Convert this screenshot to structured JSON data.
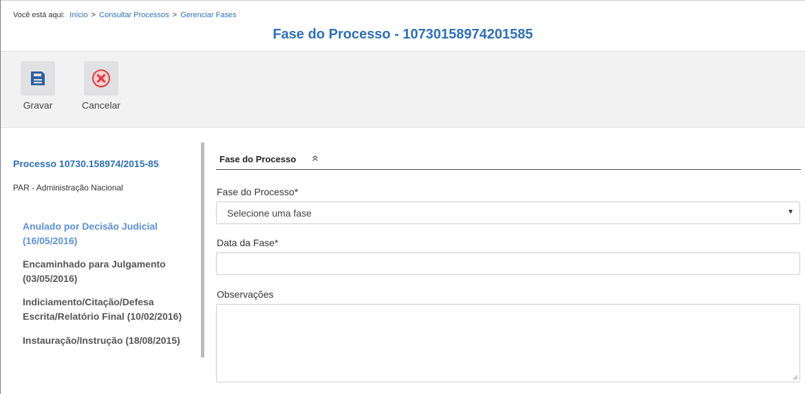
{
  "breadcrumb": {
    "prefix": "Você está aqui:",
    "items": [
      "Início",
      "Consultar Processos",
      "Gerenciar Fases"
    ],
    "separator": ">"
  },
  "page": {
    "title": "Fase do Processo - 10730158974201585"
  },
  "toolbar": {
    "save_label": "Gravar",
    "cancel_label": "Cancelar",
    "save_icon": "save-disk-icon",
    "cancel_icon": "cancel-x-circle-icon"
  },
  "sidebar": {
    "process_title": "Processo 10730.158974/2015-85",
    "process_subtitle": "PAR - Administração Nacional",
    "phases": [
      {
        "label": "Anulado por Decisão Judicial (16/05/2016)",
        "active": true
      },
      {
        "label": "Encaminhado para Julgamento (03/05/2016)",
        "active": false
      },
      {
        "label": "Indiciamento/Citação/Defesa Escrita/Relatório Final (10/02/2016)",
        "active": false
      },
      {
        "label": "Instauração/Instrução (18/08/2015)",
        "active": false
      }
    ]
  },
  "form": {
    "section_title": "Fase do Processo",
    "section_toggle_icon": "double-chevron-up-icon",
    "phase_label": "Fase do Processo*",
    "phase_selected": "Selecione uma fase",
    "date_label": "Data da Fase*",
    "date_value": "",
    "notes_label": "Observações",
    "notes_value": ""
  },
  "colors": {
    "accent": "#2d6fb7",
    "active_phase": "#5b8fd2",
    "toolbar_bg": "#f2f2f2",
    "save_icon": "#2f5f9e",
    "cancel_icon": "#e0393e"
  }
}
